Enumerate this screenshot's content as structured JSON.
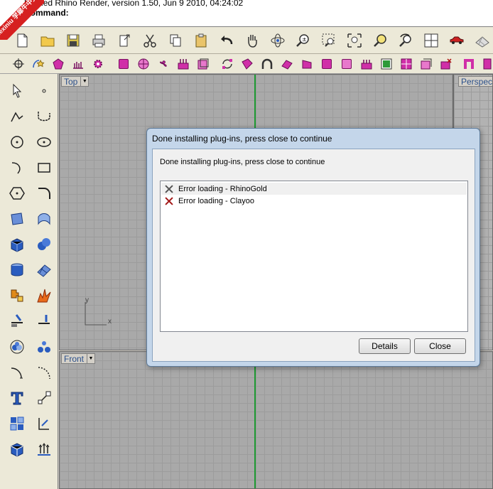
{
  "command_history": {
    "line1": "Loaded Rhino Render, version 1.50, Jun  9 2010, 04:24:02",
    "line2": "Command:"
  },
  "watermark": {
    "text": "xuexiniu 学犀牛中文网"
  },
  "viewports": {
    "top": {
      "label": "Top",
      "axis_x": "x",
      "axis_y": "y"
    },
    "perspective": {
      "label": "Perspec"
    },
    "front": {
      "label": "Front"
    }
  },
  "dialog": {
    "title": "Done installing plug-ins, press close to continue",
    "message": "Done installing plug-ins, press close to continue",
    "items": [
      {
        "text": "Error loading - RhinoGold",
        "icon": "x-gray-icon"
      },
      {
        "text": "Error loading - Clayoo",
        "icon": "x-red-icon"
      }
    ],
    "details_label": "Details",
    "close_label": "Close"
  },
  "colors": {
    "viewport_bg": "#a9a9a9",
    "axis_y": "#1e9a32",
    "axis_x": "#b03030",
    "toolbar_accent": "#d02fa8"
  }
}
